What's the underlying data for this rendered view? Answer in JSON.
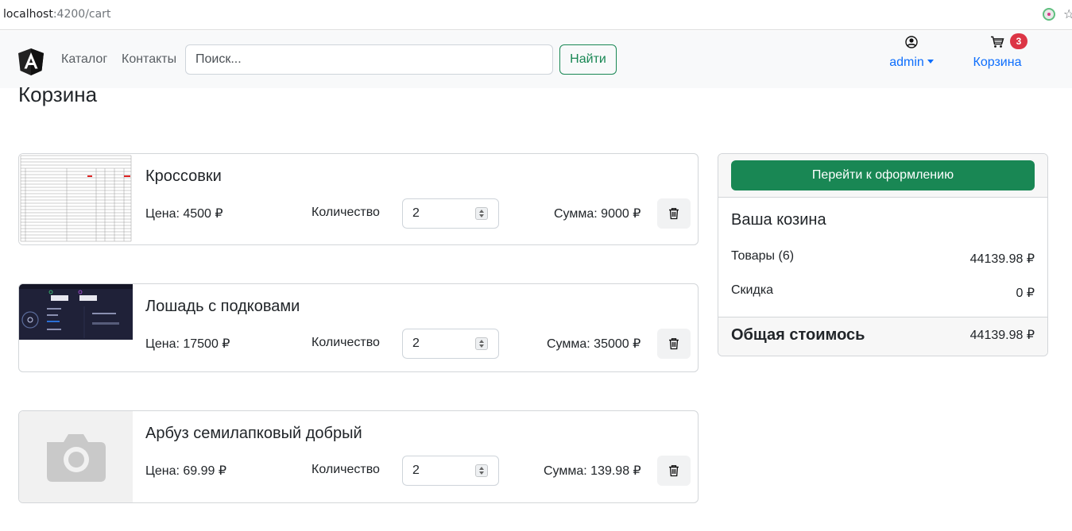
{
  "browser": {
    "url_host": "localhost",
    "url_rest": ":4200/cart"
  },
  "navbar": {
    "links": [
      "Каталог",
      "Контакты"
    ],
    "search": {
      "placeholder": "Поиск...",
      "value": ""
    },
    "search_button": "Найти",
    "user": {
      "name": "admin",
      "icon": "user-circle-icon"
    },
    "cart": {
      "label": "Корзина",
      "badge": "3",
      "icon": "cart-icon"
    }
  },
  "page": {
    "title": "Корзина"
  },
  "items": [
    {
      "name": "Кроссовки",
      "price": "Цена: 4500 ₽",
      "qty_label": "Количество",
      "qty": "2",
      "sum": "Сумма: 9000 ₽",
      "image": "spreadsheet-thumbnail"
    },
    {
      "name": "Лошадь с подковами",
      "price": "Цена: 17500 ₽",
      "qty_label": "Количество",
      "qty": "2",
      "sum": "Сумма: 35000 ₽",
      "image": "speedtest-thumbnail"
    },
    {
      "name": "Арбуз семилапковый добрый",
      "price": "Цена: 69.99 ₽",
      "qty_label": "Количество",
      "qty": "2",
      "sum": "Сумма: 139.98 ₽",
      "image": "camera-placeholder"
    }
  ],
  "summary": {
    "checkout_button": "Перейти к оформлению",
    "title": "Ваша козина",
    "rows": [
      {
        "label": "Товары (6)",
        "value": "44139.98 ₽"
      },
      {
        "label": "Скидка",
        "value": "0 ₽"
      }
    ],
    "total_label": "Общая стоимось",
    "total_value": "44139.98 ₽"
  },
  "colors": {
    "primary": "#0d6efd",
    "success": "#198754",
    "danger": "#dc3545",
    "navbar_bg": "#f8f9fa"
  }
}
